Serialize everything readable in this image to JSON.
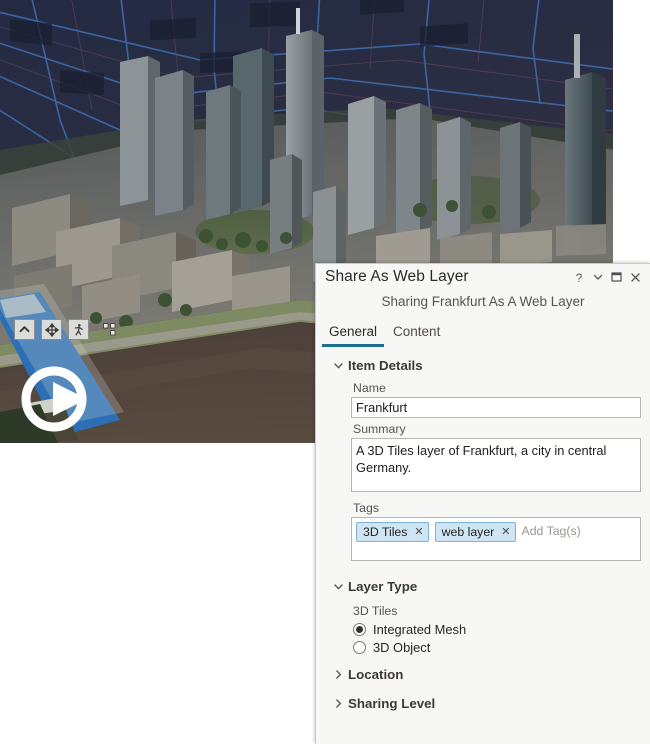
{
  "map": {
    "name": "frankfurt-3d-scene",
    "description": "3D aerial scene of Frankfurt skyline with the River Main",
    "toolbar": [
      {
        "name": "explore-tool",
        "icon": "chevron-up-icon",
        "label": "Explore"
      },
      {
        "name": "pan-tool",
        "icon": "move-arrows-icon",
        "label": "Pan"
      },
      {
        "name": "walk-tool",
        "icon": "walking-person-icon",
        "label": "Walk"
      },
      {
        "name": "full-control-tool",
        "icon": "grid-squares-icon",
        "label": "Full Control"
      }
    ],
    "navigator": {
      "name": "navigator-compass",
      "icon": "compass-arrow-icon"
    }
  },
  "dialog": {
    "title": "Share As Web Layer",
    "subtitle": "Sharing Frankfurt As A Web Layer",
    "window_buttons": [
      {
        "name": "help-button",
        "icon": "question-mark-icon",
        "glyph": "?"
      },
      {
        "name": "dropdown-button",
        "icon": "chevron-down-icon",
        "glyph": "⌄"
      },
      {
        "name": "maximize-button",
        "icon": "maximize-square-icon",
        "glyph": "❑"
      },
      {
        "name": "close-button",
        "icon": "close-x-icon",
        "glyph": "✕"
      }
    ],
    "tabs": [
      {
        "name": "tab-general",
        "label": "General",
        "active": true
      },
      {
        "name": "tab-content",
        "label": "Content",
        "active": false
      }
    ],
    "sections": {
      "item_details": {
        "heading": "Item Details",
        "expanded": true,
        "name_label": "Name",
        "name_value": "Frankfurt",
        "name_placeholder": "",
        "summary_label": "Summary",
        "summary_value": "A 3D Tiles layer of Frankfurt, a city in central Germany.",
        "summary_placeholder": "",
        "tags_label": "Tags",
        "tags": [
          {
            "label": "3D Tiles",
            "remove": "✕"
          },
          {
            "label": "web layer",
            "remove": "✕"
          }
        ],
        "tags_placeholder": "Add Tag(s)"
      },
      "layer_type": {
        "heading": "Layer Type",
        "expanded": true,
        "sub_label": "3D Tiles",
        "options": [
          {
            "label": "Integrated Mesh",
            "selected": true
          },
          {
            "label": "3D Object",
            "selected": false
          }
        ]
      },
      "location": {
        "heading": "Location",
        "expanded": false
      },
      "sharing_level": {
        "heading": "Sharing Level",
        "expanded": false
      }
    }
  },
  "colors": {
    "accent_tab_underline": "#1d6f8e",
    "panel_background": "#f7f7f5",
    "tag_fill": "#cfe5f4",
    "tag_border": "#7fb2d4",
    "heading_text": "#3d3936",
    "input_border": "#b8b8b4"
  }
}
